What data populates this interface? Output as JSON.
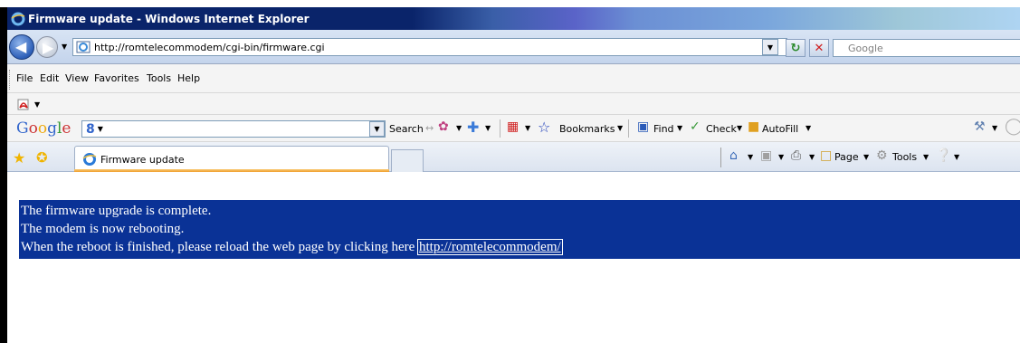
{
  "window": {
    "title": "Firmware update - Windows Internet Explorer"
  },
  "address_bar": {
    "url": "http://romtelecommodem/cgi-bin/firmware.cgi",
    "search_placeholder": "Google"
  },
  "menu": {
    "items": [
      "File",
      "Edit",
      "View",
      "Favorites",
      "Tools",
      "Help"
    ]
  },
  "google_toolbar": {
    "logo": "Google",
    "search_label": "Search",
    "bookmarks_label": "Bookmarks",
    "find_label": "Find",
    "check_label": "Check",
    "autofill_label": "AutoFill"
  },
  "tabs": {
    "active_tab_label": "Firmware update"
  },
  "command_bar": {
    "page_label": "Page",
    "tools_label": "Tools"
  },
  "content": {
    "line1": "The firmware upgrade is complete.",
    "line2": "The modem is now rebooting.",
    "line3": "When the reboot is finished, please reload the web page by clicking here",
    "link": "http://romtelecommodem/"
  },
  "icons": {
    "ie": "internet-explorer-icon",
    "back": "back-arrow-icon",
    "forward": "forward-arrow-icon",
    "refresh": "refresh-icon",
    "stop": "stop-icon",
    "favorites": "favorites-star-icon",
    "add_favorites": "add-favorites-icon",
    "home": "home-icon",
    "feeds": "rss-feed-icon",
    "print": "print-icon",
    "help": "help-icon",
    "acrobat": "acrobat-icon"
  },
  "colors": {
    "content_highlight": "#0a3296",
    "title_bar_start": "#0a246a"
  }
}
